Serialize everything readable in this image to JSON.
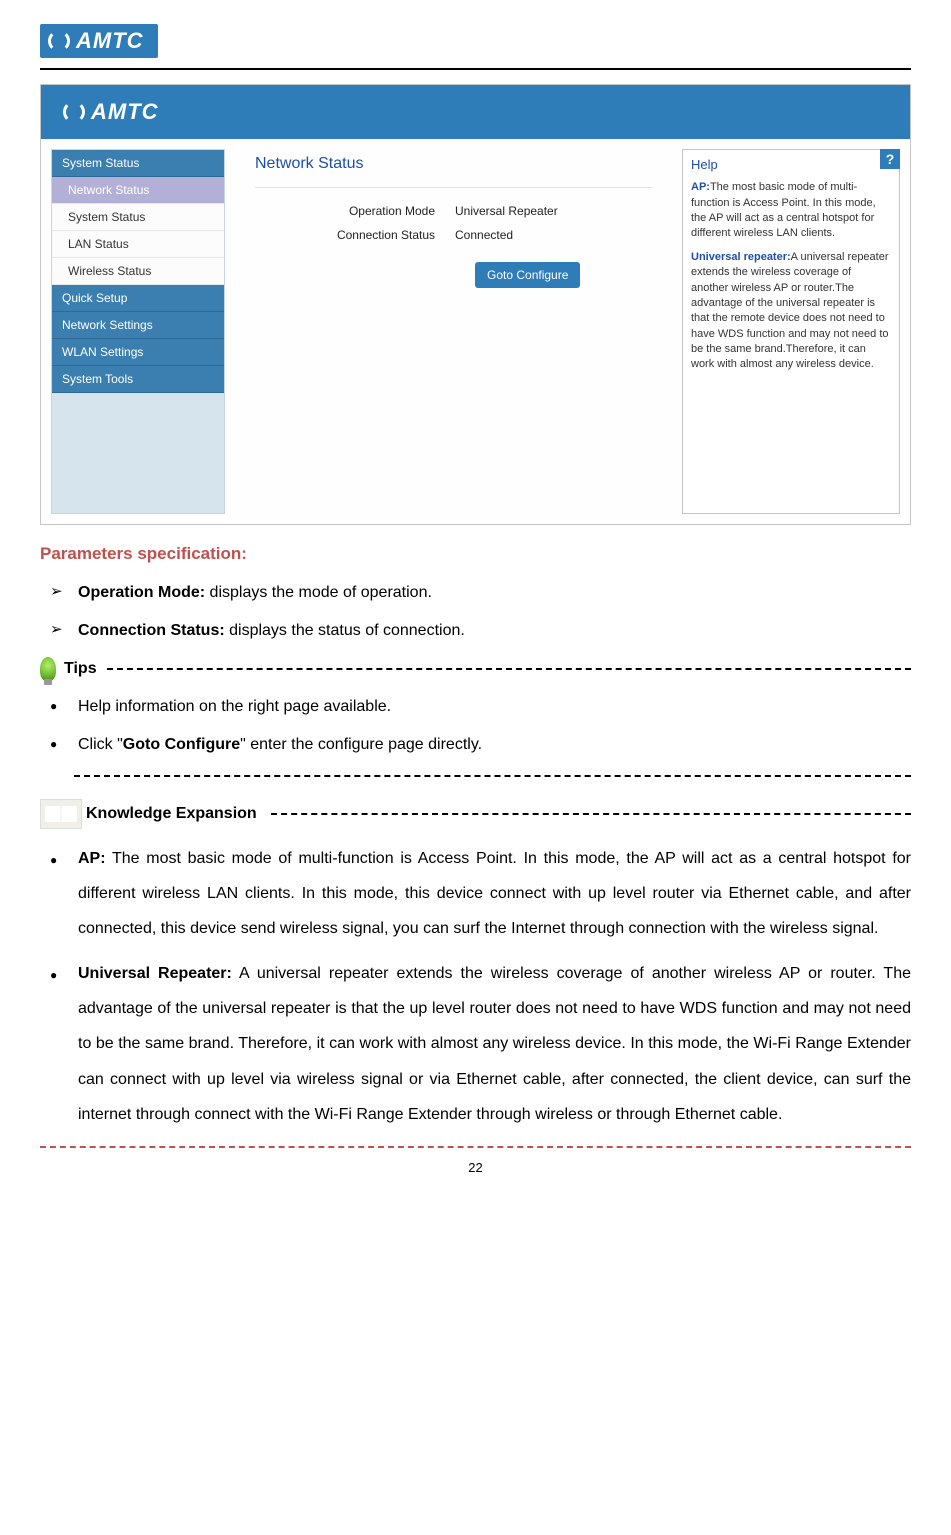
{
  "brand": "AMTC",
  "screenshot": {
    "sidebar": {
      "group1": "System Status",
      "items1": [
        "Network Status",
        "System Status",
        "LAN Status",
        "Wireless Status"
      ],
      "selectedIndex": 0,
      "group2": "Quick Setup",
      "group3": "Network Settings",
      "group4": "WLAN Settings",
      "group5": "System Tools"
    },
    "main": {
      "title": "Network Status",
      "opModeLabel": "Operation Mode",
      "opModeValue": "Universal Repeater",
      "connLabel": "Connection Status",
      "connValue": "Connected",
      "gotoBtn": "Goto Configure"
    },
    "help": {
      "title": "Help",
      "icon": "?",
      "apTerm": "AP:",
      "apText": "The most basic mode of multi-function is Access Point. In this mode, the AP will act as a central hotspot for different wireless LAN clients.",
      "urTerm": "Universal repeater:",
      "urText": "A universal repeater extends the wireless coverage of another wireless AP or router.The advantage of the universal repeater is that the remote device does not need to have WDS function and may not need to be the same brand.Therefore, it can work with almost any wireless device."
    }
  },
  "doc": {
    "paramsTitle": "Parameters specification:",
    "arrow1label": "Operation Mode:",
    "arrow1text": " displays the mode of operation.",
    "arrow2label": "Connection Status:",
    "arrow2text": " displays the status of connection.",
    "tipsLabel": "Tips",
    "tip1": "Help information on the right page available.",
    "tip2pre": "Click \"",
    "tip2bold": "Goto Configure",
    "tip2post": "\" enter the configure page directly.",
    "keLabel": "Knowledge Expansion",
    "ke1label": "AP:",
    "ke1text": " The most basic mode of multi-function is Access Point. In this mode, the AP will act as a central hotspot for different wireless LAN clients. In this mode, this device connect with up level router via Ethernet cable, and after connected, this device send wireless signal, you can surf the Internet through connection with the wireless signal.",
    "ke2label": "Universal Repeater:",
    "ke2text": " A universal repeater extends the wireless coverage of another wireless AP or router. The advantage of the universal repeater is that the up level router does not need to have WDS function and may not need to be the same brand. Therefore, it can work with almost any wireless device. In this mode, the Wi-Fi Range Extender can connect with up level via wireless signal or via Ethernet cable, after connected, the client device, can surf the internet through connect with the Wi-Fi Range Extender through wireless or through Ethernet cable.",
    "pageNum": "22"
  }
}
